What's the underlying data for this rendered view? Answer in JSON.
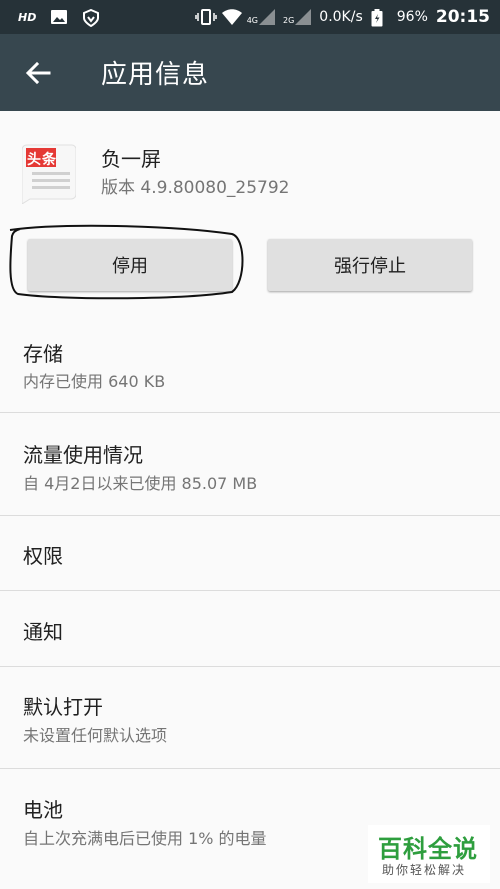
{
  "statusbar": {
    "hd": "HD",
    "net_4g": "4G",
    "net_2g": "2G",
    "speed": "0.0K/s",
    "battery": "96%",
    "time": "20:15"
  },
  "appbar": {
    "title": "应用信息"
  },
  "app": {
    "icon_text": "头条",
    "name": "负一屏",
    "version": "版本 4.9.80080_25792"
  },
  "buttons": {
    "disable": "停用",
    "force_stop": "强行停止"
  },
  "rows": [
    {
      "title": "存储",
      "subtitle": "内存已使用 640 KB"
    },
    {
      "title": "流量使用情况",
      "subtitle": "自 4月2日以来已使用 85.07 MB"
    },
    {
      "title": "权限",
      "subtitle": ""
    },
    {
      "title": "通知",
      "subtitle": ""
    },
    {
      "title": "默认打开",
      "subtitle": "未设置任何默认选项"
    },
    {
      "title": "电池",
      "subtitle": "自上次充满电后已使用 1% 的电量"
    }
  ],
  "watermark": {
    "main": "百科全说",
    "sub": "助你轻松解决"
  },
  "colors": {
    "appbar": "#37474f",
    "statusbar": "#263238",
    "icon_red": "#e53935"
  }
}
